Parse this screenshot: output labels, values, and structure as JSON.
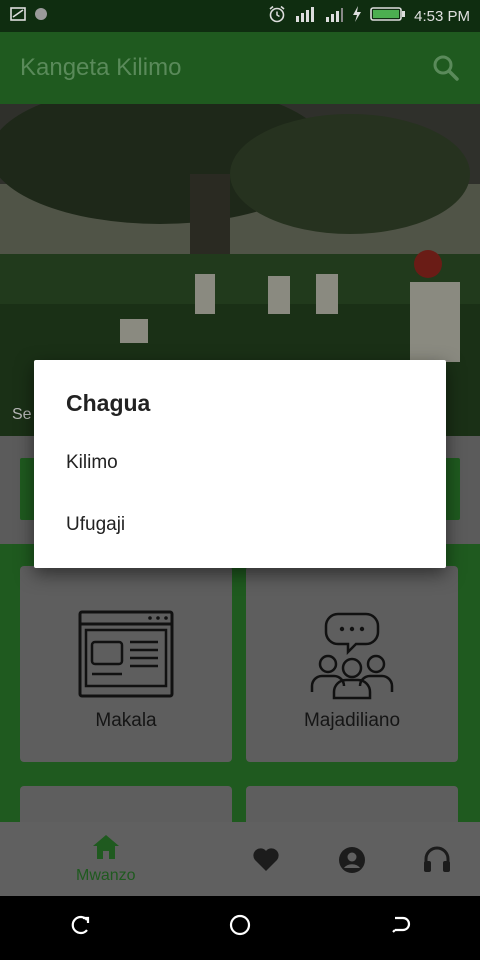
{
  "status_bar": {
    "time": "4:53 PM"
  },
  "app_bar": {
    "title": "Kangeta Kilimo"
  },
  "hero": {
    "caption": "Se"
  },
  "cards": [
    {
      "label": "Makala",
      "icon": "computer-screen-icon"
    },
    {
      "label": "Majadiliano",
      "icon": "group-chat-icon"
    }
  ],
  "bottom_nav": {
    "items": [
      {
        "label": "Mwanzo",
        "icon": "home-icon",
        "active": true
      },
      {
        "label": "",
        "icon": "heart-icon"
      },
      {
        "label": "",
        "icon": "account-icon"
      },
      {
        "label": "",
        "icon": "headphones-icon"
      }
    ]
  },
  "dialog": {
    "title": "Chagua",
    "options": [
      "Kilimo",
      "Ufugaji"
    ]
  },
  "colors": {
    "primary": "#1f5a1f",
    "scrim_gray": "#5e5e5e"
  }
}
